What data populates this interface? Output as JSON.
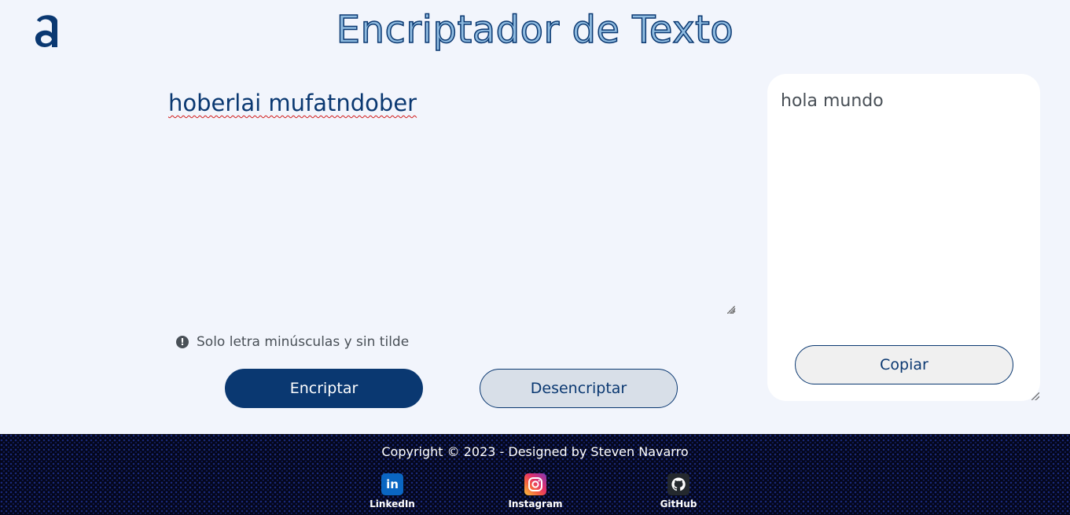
{
  "app": {
    "title": "Encriptador de Texto",
    "logo_icon": "alura-a-logo-icon",
    "accent_color": "#0a3871"
  },
  "editor": {
    "input_value": "hoberlai mufatndober",
    "hint_icon": "exclamation-circle-icon",
    "hint_text": "Solo letra minúsculas y sin tilde"
  },
  "actions": {
    "encrypt_label": "Encriptar",
    "decrypt_label": "Desencriptar"
  },
  "output": {
    "result_text": "hola mundo",
    "copy_label": "Copiar"
  },
  "footer": {
    "copyright": "Copyright © 2023 - Designed by Steven Navarro",
    "links": [
      {
        "label": "LinkedIn",
        "icon": "linkedin-icon"
      },
      {
        "label": "Instagram",
        "icon": "instagram-icon"
      },
      {
        "label": "GitHub",
        "icon": "github-icon"
      }
    ]
  }
}
